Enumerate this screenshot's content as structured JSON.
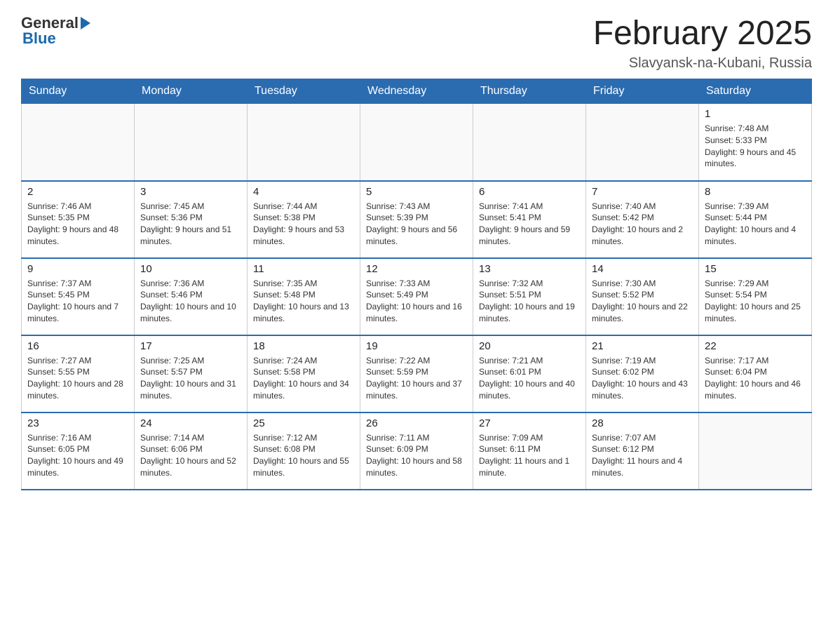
{
  "logo": {
    "general": "General",
    "blue": "Blue"
  },
  "header": {
    "title": "February 2025",
    "location": "Slavyansk-na-Kubani, Russia"
  },
  "weekdays": [
    "Sunday",
    "Monday",
    "Tuesday",
    "Wednesday",
    "Thursday",
    "Friday",
    "Saturday"
  ],
  "weeks": [
    [
      {
        "day": "",
        "info": ""
      },
      {
        "day": "",
        "info": ""
      },
      {
        "day": "",
        "info": ""
      },
      {
        "day": "",
        "info": ""
      },
      {
        "day": "",
        "info": ""
      },
      {
        "day": "",
        "info": ""
      },
      {
        "day": "1",
        "info": "Sunrise: 7:48 AM\nSunset: 5:33 PM\nDaylight: 9 hours and 45 minutes."
      }
    ],
    [
      {
        "day": "2",
        "info": "Sunrise: 7:46 AM\nSunset: 5:35 PM\nDaylight: 9 hours and 48 minutes."
      },
      {
        "day": "3",
        "info": "Sunrise: 7:45 AM\nSunset: 5:36 PM\nDaylight: 9 hours and 51 minutes."
      },
      {
        "day": "4",
        "info": "Sunrise: 7:44 AM\nSunset: 5:38 PM\nDaylight: 9 hours and 53 minutes."
      },
      {
        "day": "5",
        "info": "Sunrise: 7:43 AM\nSunset: 5:39 PM\nDaylight: 9 hours and 56 minutes."
      },
      {
        "day": "6",
        "info": "Sunrise: 7:41 AM\nSunset: 5:41 PM\nDaylight: 9 hours and 59 minutes."
      },
      {
        "day": "7",
        "info": "Sunrise: 7:40 AM\nSunset: 5:42 PM\nDaylight: 10 hours and 2 minutes."
      },
      {
        "day": "8",
        "info": "Sunrise: 7:39 AM\nSunset: 5:44 PM\nDaylight: 10 hours and 4 minutes."
      }
    ],
    [
      {
        "day": "9",
        "info": "Sunrise: 7:37 AM\nSunset: 5:45 PM\nDaylight: 10 hours and 7 minutes."
      },
      {
        "day": "10",
        "info": "Sunrise: 7:36 AM\nSunset: 5:46 PM\nDaylight: 10 hours and 10 minutes."
      },
      {
        "day": "11",
        "info": "Sunrise: 7:35 AM\nSunset: 5:48 PM\nDaylight: 10 hours and 13 minutes."
      },
      {
        "day": "12",
        "info": "Sunrise: 7:33 AM\nSunset: 5:49 PM\nDaylight: 10 hours and 16 minutes."
      },
      {
        "day": "13",
        "info": "Sunrise: 7:32 AM\nSunset: 5:51 PM\nDaylight: 10 hours and 19 minutes."
      },
      {
        "day": "14",
        "info": "Sunrise: 7:30 AM\nSunset: 5:52 PM\nDaylight: 10 hours and 22 minutes."
      },
      {
        "day": "15",
        "info": "Sunrise: 7:29 AM\nSunset: 5:54 PM\nDaylight: 10 hours and 25 minutes."
      }
    ],
    [
      {
        "day": "16",
        "info": "Sunrise: 7:27 AM\nSunset: 5:55 PM\nDaylight: 10 hours and 28 minutes."
      },
      {
        "day": "17",
        "info": "Sunrise: 7:25 AM\nSunset: 5:57 PM\nDaylight: 10 hours and 31 minutes."
      },
      {
        "day": "18",
        "info": "Sunrise: 7:24 AM\nSunset: 5:58 PM\nDaylight: 10 hours and 34 minutes."
      },
      {
        "day": "19",
        "info": "Sunrise: 7:22 AM\nSunset: 5:59 PM\nDaylight: 10 hours and 37 minutes."
      },
      {
        "day": "20",
        "info": "Sunrise: 7:21 AM\nSunset: 6:01 PM\nDaylight: 10 hours and 40 minutes."
      },
      {
        "day": "21",
        "info": "Sunrise: 7:19 AM\nSunset: 6:02 PM\nDaylight: 10 hours and 43 minutes."
      },
      {
        "day": "22",
        "info": "Sunrise: 7:17 AM\nSunset: 6:04 PM\nDaylight: 10 hours and 46 minutes."
      }
    ],
    [
      {
        "day": "23",
        "info": "Sunrise: 7:16 AM\nSunset: 6:05 PM\nDaylight: 10 hours and 49 minutes."
      },
      {
        "day": "24",
        "info": "Sunrise: 7:14 AM\nSunset: 6:06 PM\nDaylight: 10 hours and 52 minutes."
      },
      {
        "day": "25",
        "info": "Sunrise: 7:12 AM\nSunset: 6:08 PM\nDaylight: 10 hours and 55 minutes."
      },
      {
        "day": "26",
        "info": "Sunrise: 7:11 AM\nSunset: 6:09 PM\nDaylight: 10 hours and 58 minutes."
      },
      {
        "day": "27",
        "info": "Sunrise: 7:09 AM\nSunset: 6:11 PM\nDaylight: 11 hours and 1 minute."
      },
      {
        "day": "28",
        "info": "Sunrise: 7:07 AM\nSunset: 6:12 PM\nDaylight: 11 hours and 4 minutes."
      },
      {
        "day": "",
        "info": ""
      }
    ]
  ]
}
